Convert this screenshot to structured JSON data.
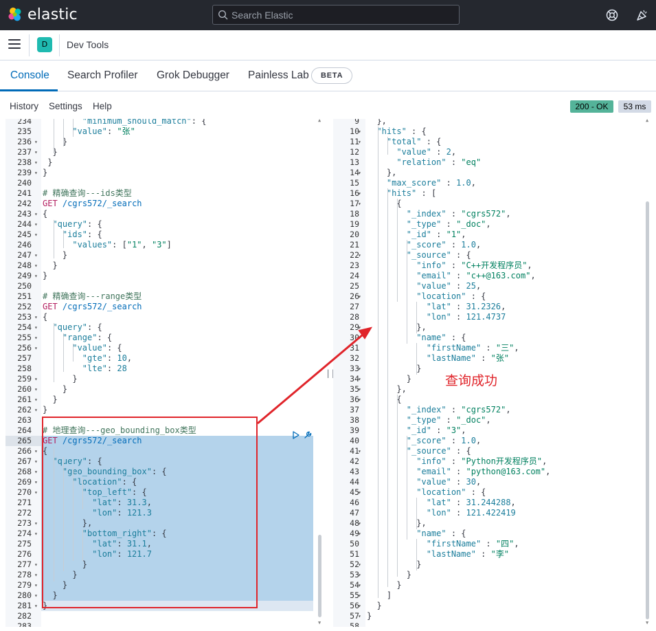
{
  "header": {
    "brand": "elastic",
    "search_placeholder": "Search Elastic",
    "help_icon": "help-lifebuoy-icon",
    "news_icon": "newsfeed-cheer-icon"
  },
  "appbar": {
    "space_initial": "D",
    "breadcrumb": "Dev Tools"
  },
  "tabs": [
    {
      "label": "Console",
      "active": true
    },
    {
      "label": "Search Profiler"
    },
    {
      "label": "Grok Debugger"
    },
    {
      "label": "Painless Lab"
    }
  ],
  "beta_badge": "BETA",
  "console_menu": [
    "History",
    "Settings",
    "Help"
  ],
  "status": {
    "code": "200 - OK",
    "time": "53 ms"
  },
  "annotation": {
    "text": "查询成功"
  },
  "colors": {
    "accent": "#006bb8",
    "ok": "#54b399",
    "annotation": "#e0242a",
    "selection": "#b4d3eb"
  },
  "request_editor": {
    "first_line": 234,
    "lines": [
      {
        "n": 234,
        "fold": false,
        "text": "        \"minimum_should_match\": {"
      },
      {
        "n": 235,
        "fold": false,
        "text": "      \"value\": \"张\""
      },
      {
        "n": 236,
        "fold": true,
        "text": "    }"
      },
      {
        "n": 237,
        "fold": true,
        "text": "  }"
      },
      {
        "n": 238,
        "fold": true,
        "text": " }"
      },
      {
        "n": 239,
        "fold": true,
        "text": "}"
      },
      {
        "n": 240,
        "fold": false,
        "text": ""
      },
      {
        "n": 241,
        "fold": false,
        "text": "# 精确查询---ids类型"
      },
      {
        "n": 242,
        "fold": false,
        "text": "GET /cgrs572/_search"
      },
      {
        "n": 243,
        "fold": true,
        "text": "{"
      },
      {
        "n": 244,
        "fold": true,
        "text": "  \"query\": {"
      },
      {
        "n": 245,
        "fold": true,
        "text": "    \"ids\": {"
      },
      {
        "n": 246,
        "fold": false,
        "text": "      \"values\": [\"1\", \"3\"]"
      },
      {
        "n": 247,
        "fold": true,
        "text": "    }"
      },
      {
        "n": 248,
        "fold": true,
        "text": "  }"
      },
      {
        "n": 249,
        "fold": true,
        "text": "}"
      },
      {
        "n": 250,
        "fold": false,
        "text": ""
      },
      {
        "n": 251,
        "fold": false,
        "text": "# 精确查询---range类型"
      },
      {
        "n": 252,
        "fold": false,
        "text": "GET /cgrs572/_search"
      },
      {
        "n": 253,
        "fold": true,
        "text": "{"
      },
      {
        "n": 254,
        "fold": true,
        "text": "  \"query\": {"
      },
      {
        "n": 255,
        "fold": true,
        "text": "    \"range\": {"
      },
      {
        "n": 256,
        "fold": true,
        "text": "      \"value\": {"
      },
      {
        "n": 257,
        "fold": false,
        "text": "        \"gte\": 10,"
      },
      {
        "n": 258,
        "fold": false,
        "text": "        \"lte\": 28"
      },
      {
        "n": 259,
        "fold": true,
        "text": "      }"
      },
      {
        "n": 260,
        "fold": true,
        "text": "    }"
      },
      {
        "n": 261,
        "fold": true,
        "text": "  }"
      },
      {
        "n": 262,
        "fold": true,
        "text": "}"
      },
      {
        "n": 263,
        "fold": false,
        "text": ""
      },
      {
        "n": 264,
        "fold": false,
        "text": "# 地理查询---geo_bounding_box类型"
      },
      {
        "n": 265,
        "fold": false,
        "text": "GET /cgrs572/_search"
      },
      {
        "n": 266,
        "fold": true,
        "text": "{"
      },
      {
        "n": 267,
        "fold": true,
        "text": "  \"query\": {"
      },
      {
        "n": 268,
        "fold": true,
        "text": "    \"geo_bounding_box\": {"
      },
      {
        "n": 269,
        "fold": true,
        "text": "      \"location\": {"
      },
      {
        "n": 270,
        "fold": true,
        "text": "        \"top_left\": {"
      },
      {
        "n": 271,
        "fold": false,
        "text": "          \"lat\": 31.3,"
      },
      {
        "n": 272,
        "fold": false,
        "text": "          \"lon\": 121.3"
      },
      {
        "n": 273,
        "fold": true,
        "text": "        },"
      },
      {
        "n": 274,
        "fold": true,
        "text": "        \"bottom_right\": {"
      },
      {
        "n": 275,
        "fold": false,
        "text": "          \"lat\": 31.1,"
      },
      {
        "n": 276,
        "fold": false,
        "text": "          \"lon\": 121.7"
      },
      {
        "n": 277,
        "fold": true,
        "text": "        }"
      },
      {
        "n": 278,
        "fold": true,
        "text": "      }"
      },
      {
        "n": 279,
        "fold": true,
        "text": "    }"
      },
      {
        "n": 280,
        "fold": true,
        "text": "  }"
      },
      {
        "n": 281,
        "fold": true,
        "text": "}"
      },
      {
        "n": 282,
        "fold": false,
        "text": ""
      },
      {
        "n": 283,
        "fold": false,
        "text": ""
      }
    ]
  },
  "response_editor": {
    "lines": [
      {
        "n": 9,
        "fold": false,
        "text": "  },"
      },
      {
        "n": 10,
        "fold": true,
        "text": "  \"hits\" : {"
      },
      {
        "n": 11,
        "fold": true,
        "text": "    \"total\" : {"
      },
      {
        "n": 12,
        "fold": false,
        "text": "      \"value\" : 2,"
      },
      {
        "n": 13,
        "fold": false,
        "text": "      \"relation\" : \"eq\""
      },
      {
        "n": 14,
        "fold": true,
        "text": "    },"
      },
      {
        "n": 15,
        "fold": false,
        "text": "    \"max_score\" : 1.0,"
      },
      {
        "n": 16,
        "fold": true,
        "text": "    \"hits\" : ["
      },
      {
        "n": 17,
        "fold": true,
        "text": "      {"
      },
      {
        "n": 18,
        "fold": false,
        "text": "        \"_index\" : \"cgrs572\","
      },
      {
        "n": 19,
        "fold": false,
        "text": "        \"_type\" : \"_doc\","
      },
      {
        "n": 20,
        "fold": false,
        "text": "        \"_id\" : \"1\","
      },
      {
        "n": 21,
        "fold": false,
        "text": "        \"_score\" : 1.0,"
      },
      {
        "n": 22,
        "fold": true,
        "text": "        \"_source\" : {"
      },
      {
        "n": 23,
        "fold": false,
        "text": "          \"info\" : \"C++开发程序员\","
      },
      {
        "n": 24,
        "fold": false,
        "text": "          \"email\" : \"c++@163.com\","
      },
      {
        "n": 25,
        "fold": false,
        "text": "          \"value\" : 25,"
      },
      {
        "n": 26,
        "fold": true,
        "text": "          \"location\" : {"
      },
      {
        "n": 27,
        "fold": false,
        "text": "            \"lat\" : 31.2326,"
      },
      {
        "n": 28,
        "fold": false,
        "text": "            \"lon\" : 121.4737"
      },
      {
        "n": 29,
        "fold": true,
        "text": "          },"
      },
      {
        "n": 30,
        "fold": true,
        "text": "          \"name\" : {"
      },
      {
        "n": 31,
        "fold": false,
        "text": "            \"firstName\" : \"三\","
      },
      {
        "n": 32,
        "fold": false,
        "text": "            \"lastName\" : \"张\""
      },
      {
        "n": 33,
        "fold": true,
        "text": "          }"
      },
      {
        "n": 34,
        "fold": true,
        "text": "        }"
      },
      {
        "n": 35,
        "fold": true,
        "text": "      },"
      },
      {
        "n": 36,
        "fold": true,
        "text": "      {"
      },
      {
        "n": 37,
        "fold": false,
        "text": "        \"_index\" : \"cgrs572\","
      },
      {
        "n": 38,
        "fold": false,
        "text": "        \"_type\" : \"_doc\","
      },
      {
        "n": 39,
        "fold": false,
        "text": "        \"_id\" : \"3\","
      },
      {
        "n": 40,
        "fold": false,
        "text": "        \"_score\" : 1.0,"
      },
      {
        "n": 41,
        "fold": true,
        "text": "        \"_source\" : {"
      },
      {
        "n": 42,
        "fold": false,
        "text": "          \"info\" : \"Python开发程序员\","
      },
      {
        "n": 43,
        "fold": false,
        "text": "          \"email\" : \"python@163.com\","
      },
      {
        "n": 44,
        "fold": false,
        "text": "          \"value\" : 30,"
      },
      {
        "n": 45,
        "fold": true,
        "text": "          \"location\" : {"
      },
      {
        "n": 46,
        "fold": false,
        "text": "            \"lat\" : 31.244288,"
      },
      {
        "n": 47,
        "fold": false,
        "text": "            \"lon\" : 121.422419"
      },
      {
        "n": 48,
        "fold": true,
        "text": "          },"
      },
      {
        "n": 49,
        "fold": true,
        "text": "          \"name\" : {"
      },
      {
        "n": 50,
        "fold": false,
        "text": "            \"firstName\" : \"四\","
      },
      {
        "n": 51,
        "fold": false,
        "text": "            \"lastName\" : \"李\""
      },
      {
        "n": 52,
        "fold": true,
        "text": "          }"
      },
      {
        "n": 53,
        "fold": true,
        "text": "        }"
      },
      {
        "n": 54,
        "fold": true,
        "text": "      }"
      },
      {
        "n": 55,
        "fold": true,
        "text": "    ]"
      },
      {
        "n": 56,
        "fold": true,
        "text": "  }"
      },
      {
        "n": 57,
        "fold": true,
        "text": "}"
      },
      {
        "n": 58,
        "fold": false,
        "text": ""
      }
    ]
  }
}
